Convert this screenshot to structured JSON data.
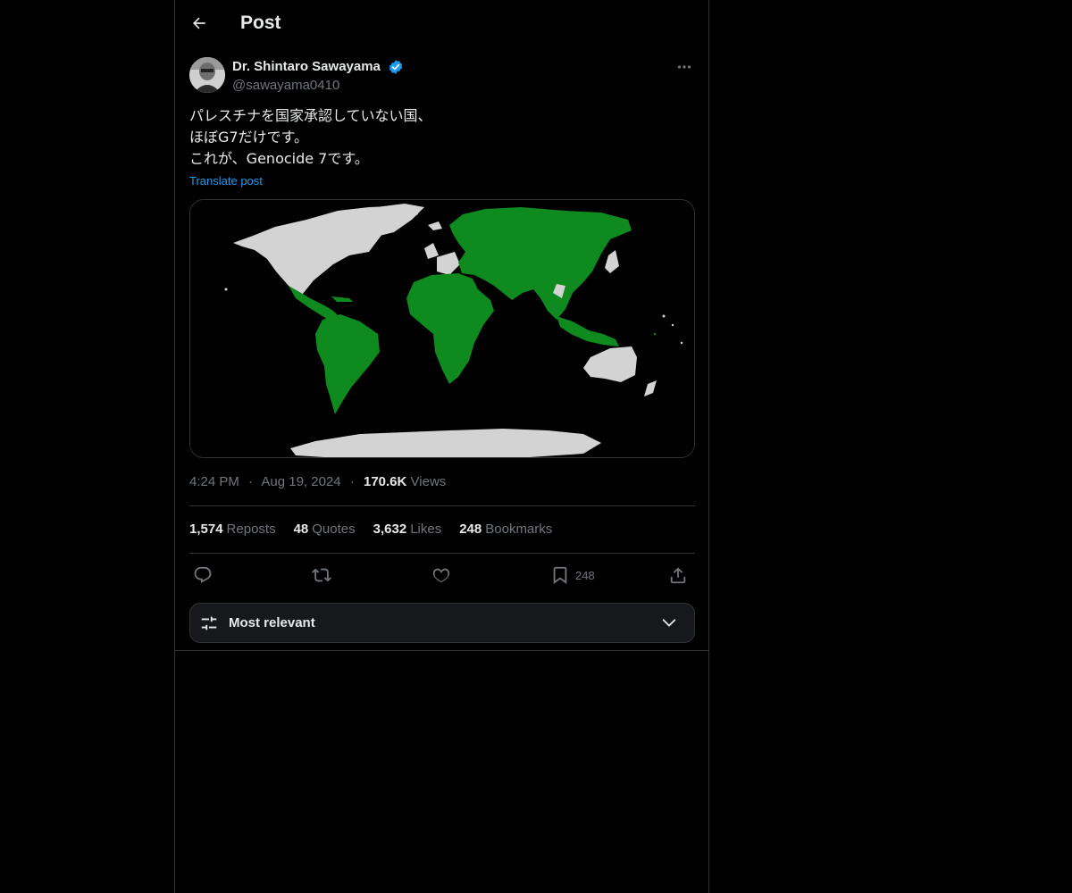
{
  "header": {
    "title": "Post",
    "back_icon": "arrow-left-icon"
  },
  "author": {
    "display_name": "Dr. Shintaro Sawayama",
    "handle": "@sawayama0410",
    "verified_icon": "verified-badge-icon",
    "verified_color": "#1d9bf0"
  },
  "post": {
    "lines": [
      "パレスチナを国家承認していない国、",
      "ほぼG7だけです。",
      "これが、Genocide 7です。"
    ],
    "translate_label": "Translate post",
    "media_icon": "world-map-image",
    "map_colors": {
      "recognized": "#0e8a1e",
      "not_recognized": "#d3d3d3",
      "background": "#000000"
    }
  },
  "meta": {
    "time": "4:24 PM",
    "separator": "·",
    "date": "Aug 19, 2024",
    "views_count": "170.6K",
    "views_label": "Views"
  },
  "stats": {
    "reposts_count": "1,574",
    "reposts_label": "Reposts",
    "quotes_count": "48",
    "quotes_label": "Quotes",
    "likes_count": "3,632",
    "likes_label": "Likes",
    "bookmarks_count": "248",
    "bookmarks_label": "Bookmarks"
  },
  "actions": {
    "reply_icon": "reply-icon",
    "repost_icon": "repost-icon",
    "like_icon": "heart-icon",
    "bookmark_icon": "bookmark-icon",
    "bookmark_count": "248",
    "share_icon": "share-icon"
  },
  "sort": {
    "label": "Most relevant",
    "icon": "sliders-icon",
    "chevron_icon": "chevron-down-icon"
  },
  "colors": {
    "background": "#000000",
    "text": "#e7e9ea",
    "muted": "#71767b",
    "border": "#2f3336",
    "link": "#1d9bf0"
  }
}
